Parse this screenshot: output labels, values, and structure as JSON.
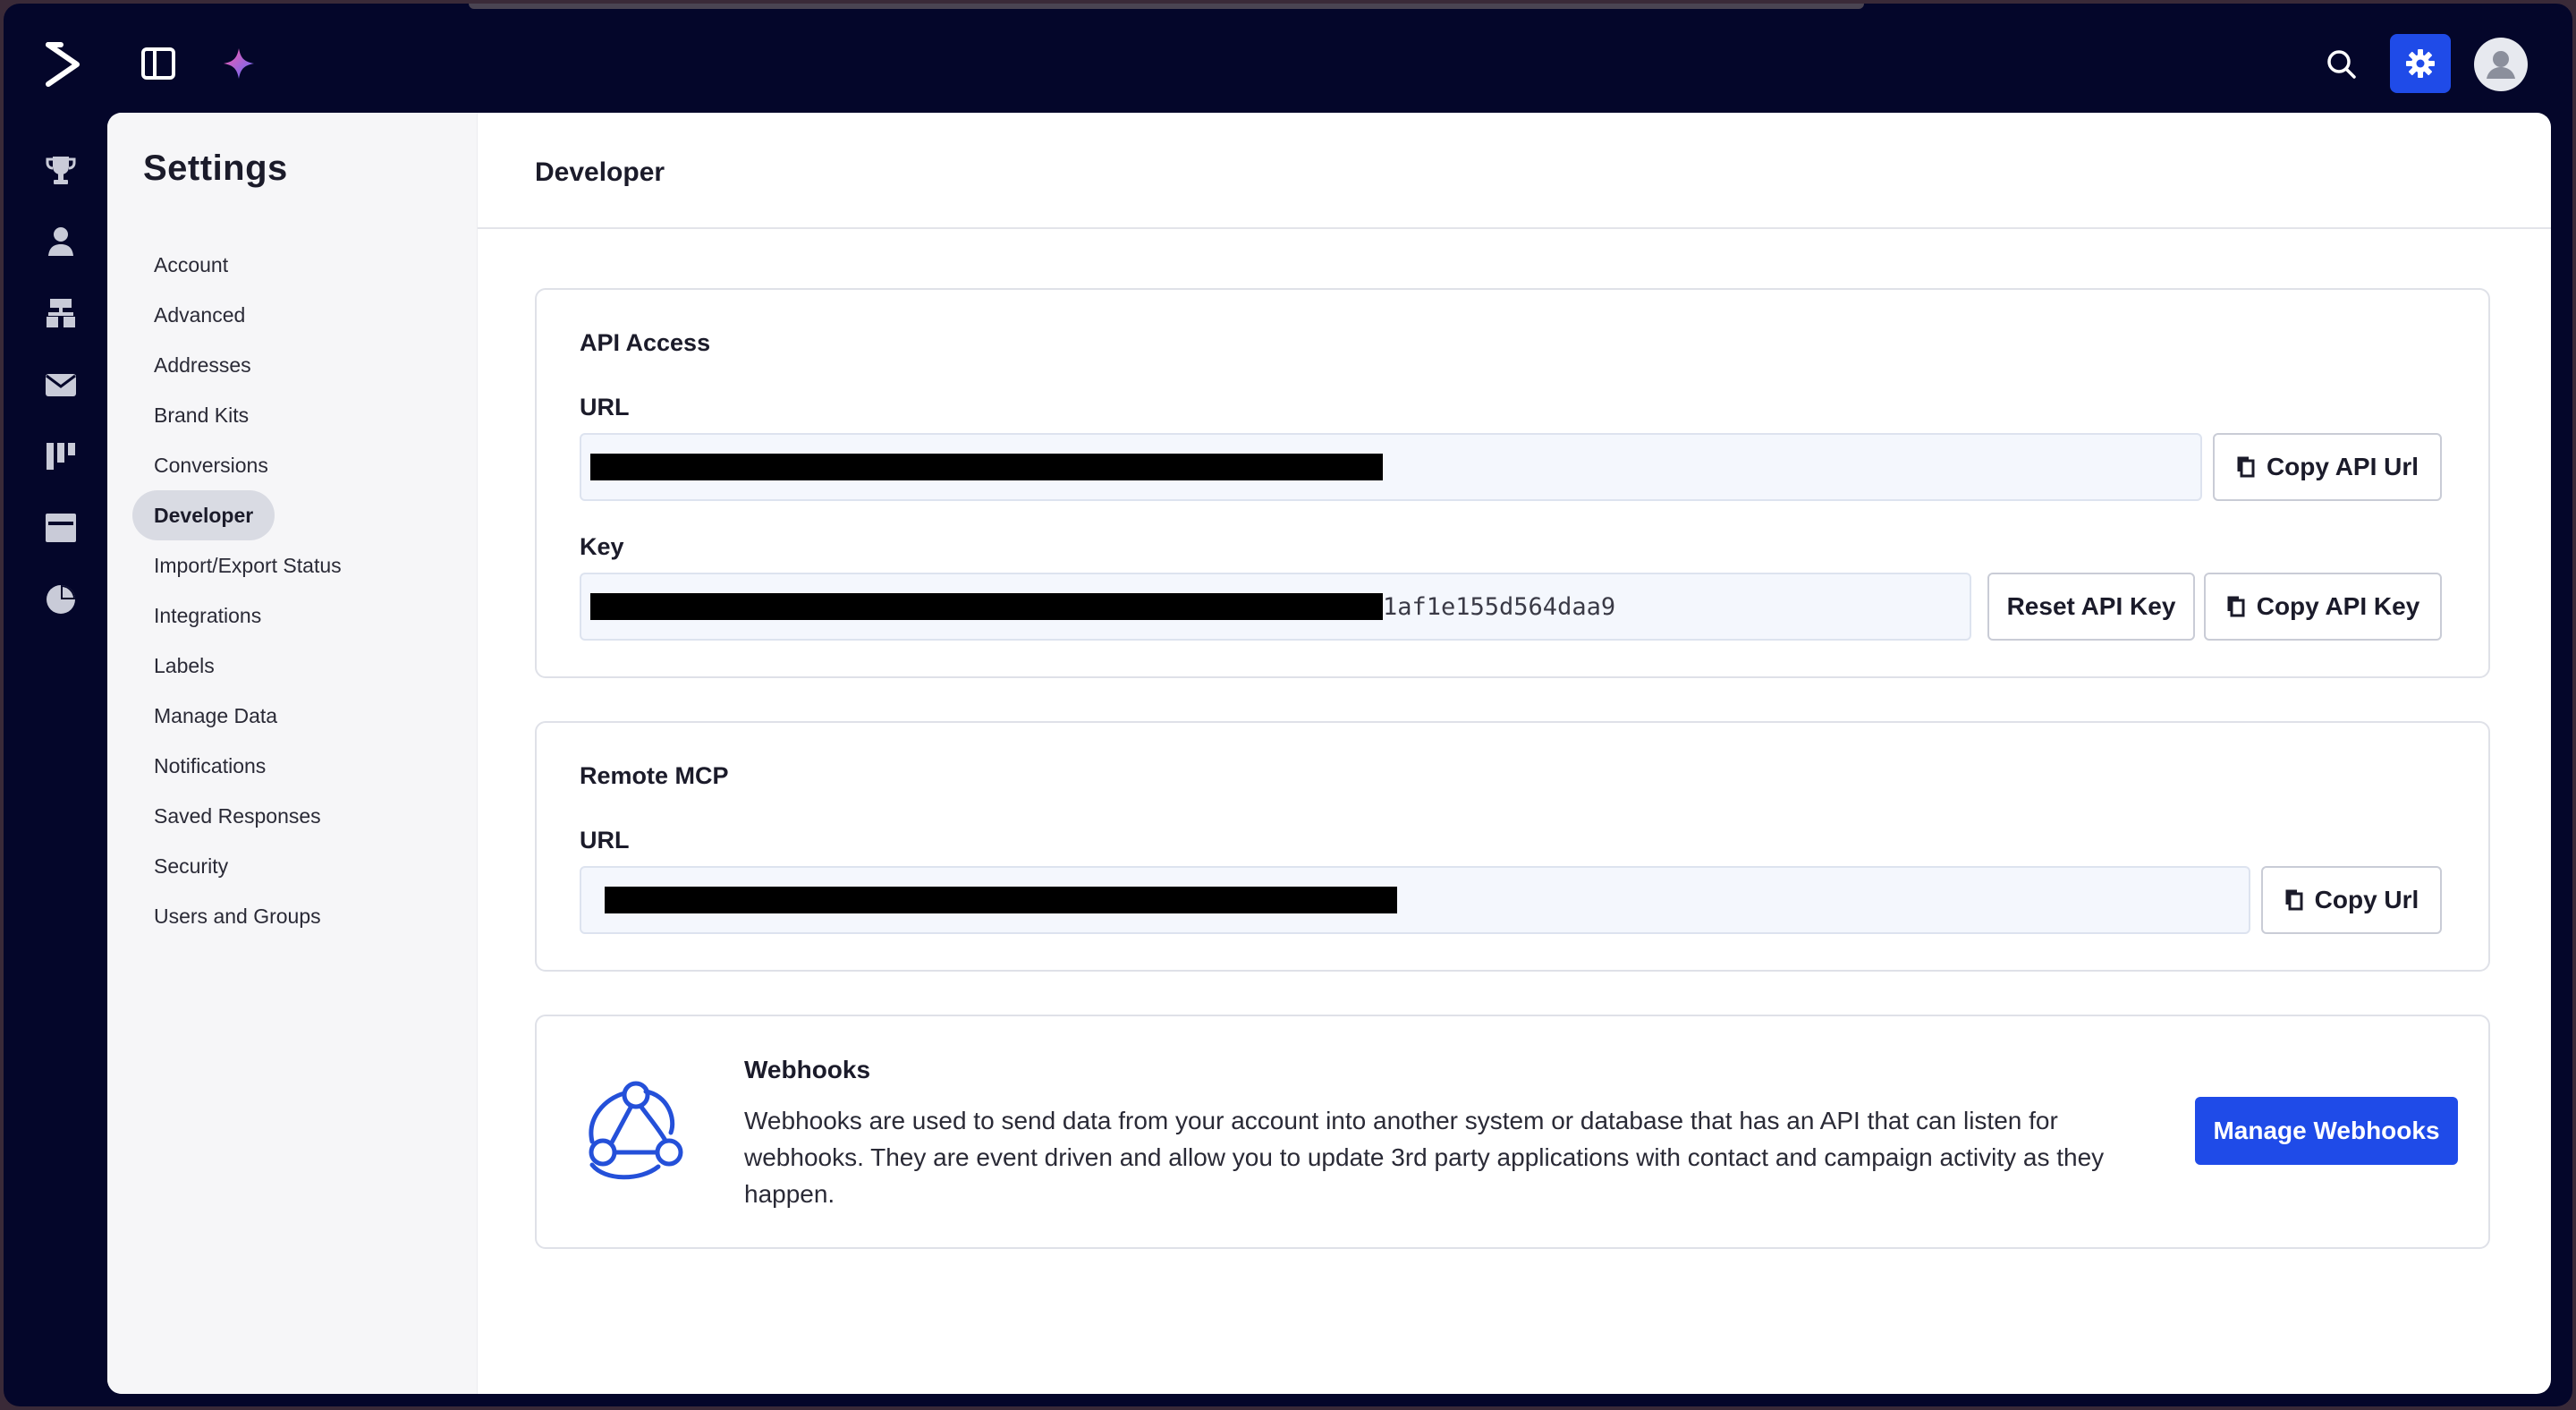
{
  "topbar": {
    "icons": [
      "logo-chevron-icon",
      "panel-toggle-icon",
      "sparkle-icon",
      "search-icon",
      "gear-icon",
      "user-avatar-icon"
    ]
  },
  "rail": {
    "icons": [
      "trophy-icon",
      "person-icon",
      "sitemap-icon",
      "envelope-icon",
      "kanban-icon",
      "browser-window-icon",
      "pie-chart-icon"
    ]
  },
  "sidebar": {
    "title": "Settings",
    "items": [
      {
        "label": "Account"
      },
      {
        "label": "Advanced"
      },
      {
        "label": "Addresses"
      },
      {
        "label": "Brand Kits"
      },
      {
        "label": "Conversions"
      },
      {
        "label": "Developer",
        "active": true
      },
      {
        "label": "Import/Export Status"
      },
      {
        "label": "Integrations"
      },
      {
        "label": "Labels"
      },
      {
        "label": "Manage Data"
      },
      {
        "label": "Notifications"
      },
      {
        "label": "Saved Responses"
      },
      {
        "label": "Security"
      },
      {
        "label": "Users and Groups"
      }
    ]
  },
  "page": {
    "title": "Developer"
  },
  "api_access": {
    "title": "API Access",
    "url_label": "URL",
    "url_value": "",
    "copy_url_button": "Copy API Url",
    "key_label": "Key",
    "key_value_visible": "1af1e155d564daa9",
    "reset_key_button": "Reset API Key",
    "copy_key_button": "Copy API Key"
  },
  "remote_mcp": {
    "title": "Remote MCP",
    "url_label": "URL",
    "url_value": "",
    "copy_url_button": "Copy Url"
  },
  "webhooks": {
    "title": "Webhooks",
    "description": "Webhooks are used to send data from your account into another system or database that has an API that can listen for webhooks. They are event driven and allow you to update 3rd party applications with contact and campaign activity as they happen.",
    "manage_button": "Manage Webhooks"
  },
  "colors": {
    "frame_bg": "#04062a",
    "accent": "#1f4be8",
    "input_bg": "#f4f7fd",
    "active_nav_bg": "#d9dbe3"
  }
}
